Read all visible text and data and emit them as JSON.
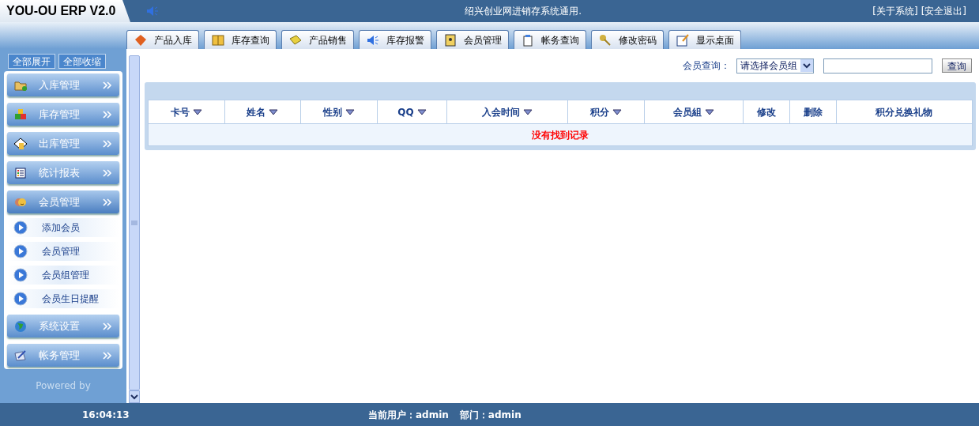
{
  "header": {
    "title": "YOU-OU ERP V2.0",
    "notice": "绍兴创业网进销存系统通用.",
    "links": [
      "[关于系统]",
      "[安全退出]"
    ]
  },
  "tabs": [
    {
      "label": "产品入库"
    },
    {
      "label": "库存查询"
    },
    {
      "label": "产品销售"
    },
    {
      "label": "库存报警"
    },
    {
      "label": "会员管理"
    },
    {
      "label": "帐务查询"
    },
    {
      "label": "修改密码"
    },
    {
      "label": "显示桌面"
    }
  ],
  "sidebar": {
    "buttons": [
      "全部展开",
      "全部收缩"
    ],
    "menu": [
      {
        "label": "入库管理",
        "expanded": false
      },
      {
        "label": "库存管理",
        "expanded": false
      },
      {
        "label": "出库管理",
        "expanded": false
      },
      {
        "label": "统计报表",
        "expanded": false
      },
      {
        "label": "会员管理",
        "expanded": true,
        "children": [
          "添加会员",
          "会员管理",
          "会员组管理",
          "会员生日提醒"
        ]
      },
      {
        "label": "系统设置",
        "expanded": false
      },
      {
        "label": "帐务管理",
        "expanded": false
      }
    ],
    "powered": "Powered by"
  },
  "search": {
    "label": "会员查询：",
    "group": "请选择会员组",
    "button": "查询"
  },
  "table": {
    "columns": [
      {
        "label": "卡号",
        "sortable": true
      },
      {
        "label": "姓名",
        "sortable": true
      },
      {
        "label": "性别",
        "sortable": true
      },
      {
        "label": "QQ",
        "sortable": true
      },
      {
        "label": "入会时间",
        "sortable": true
      },
      {
        "label": "积分",
        "sortable": true
      },
      {
        "label": "会员組",
        "sortable": true
      },
      {
        "label": "修改",
        "sortable": false
      },
      {
        "label": "删除",
        "sortable": false
      },
      {
        "label": "积分兑换礼物",
        "sortable": false
      }
    ],
    "empty": "没有找到记录"
  },
  "status_bar": {
    "time": "16:04:13",
    "user": "当前用户：admin",
    "dept": "部门：admin"
  }
}
